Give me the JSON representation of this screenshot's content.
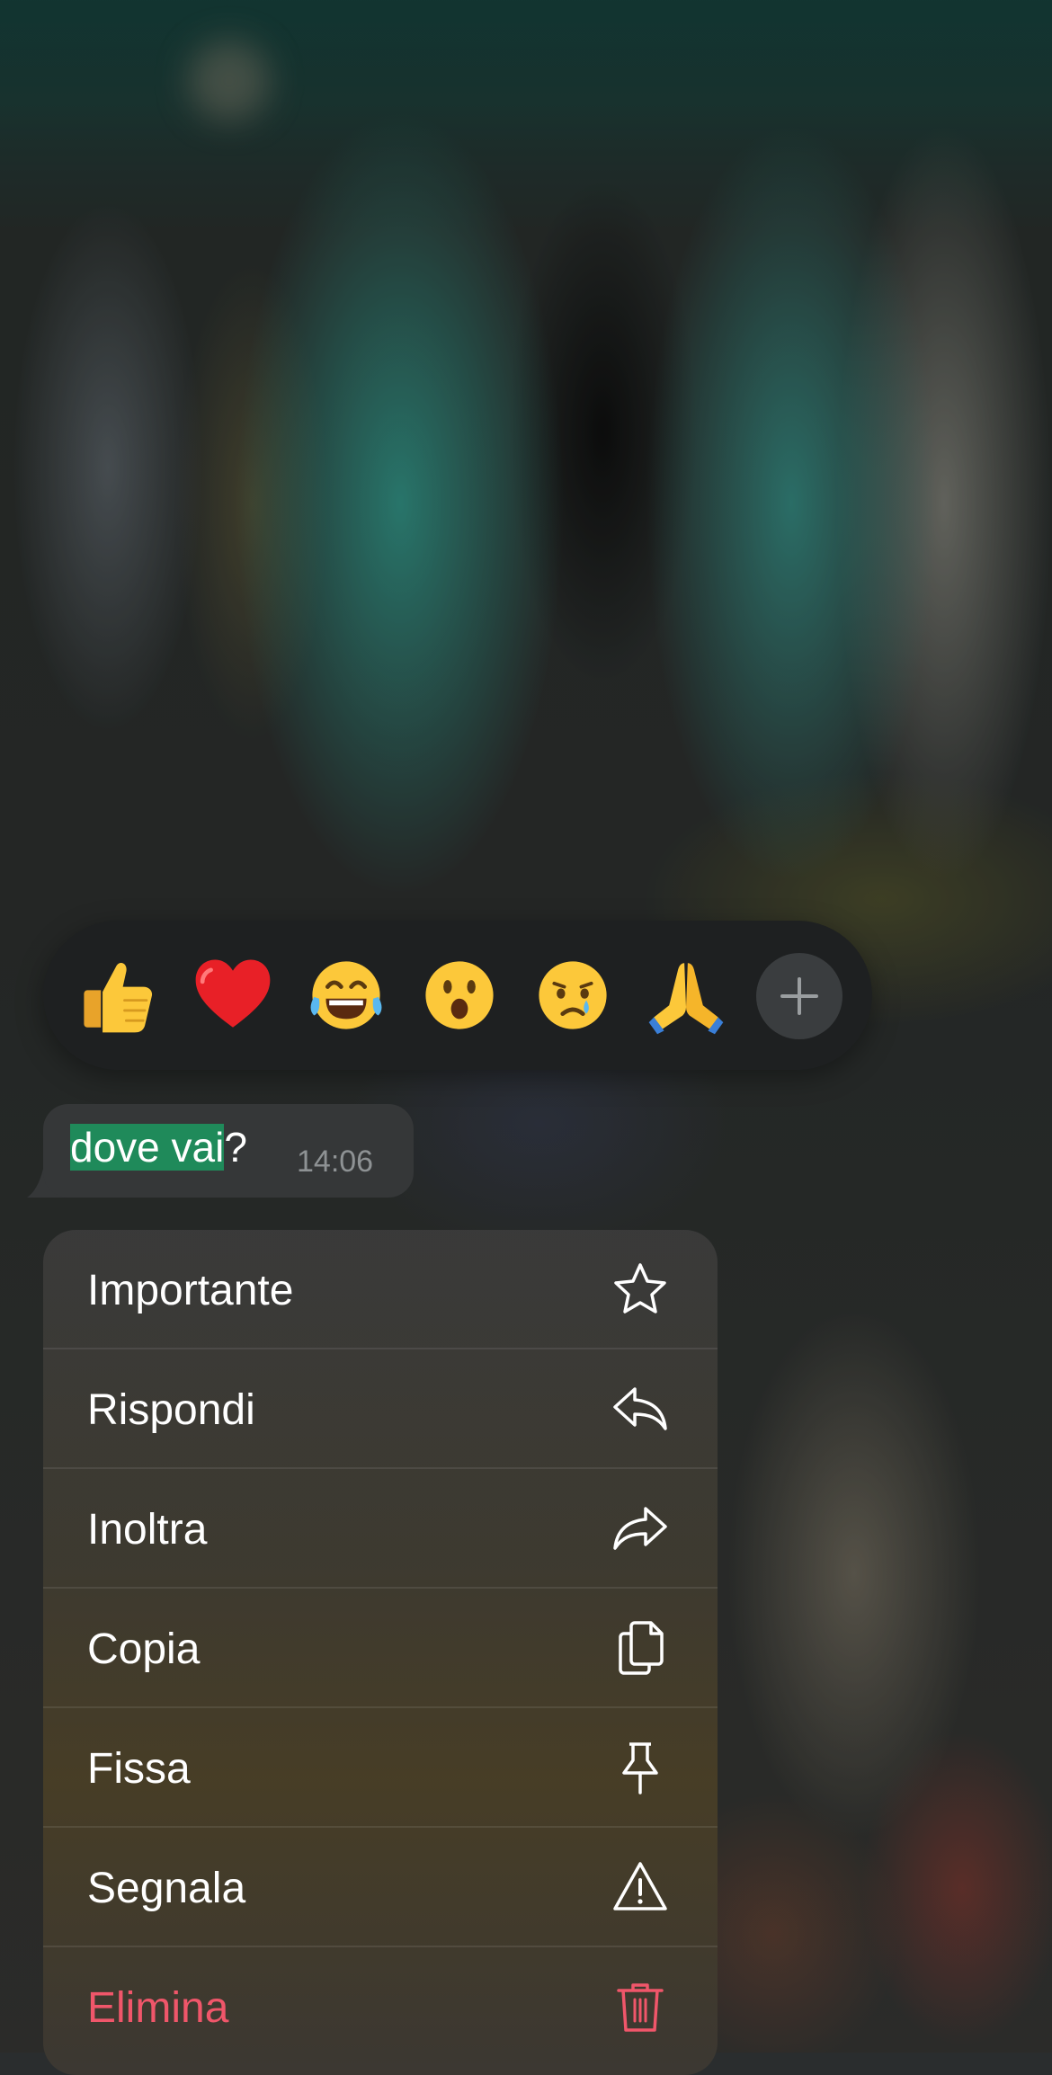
{
  "reactions": {
    "items": [
      {
        "emoji": "👍",
        "icon": "thumbs-up-icon"
      },
      {
        "emoji": "❤️",
        "icon": "red-heart-icon"
      },
      {
        "emoji": "😂",
        "icon": "tears-of-joy-icon"
      },
      {
        "emoji": "😮",
        "icon": "open-mouth-icon"
      },
      {
        "emoji": "😢",
        "icon": "crying-face-icon"
      },
      {
        "emoji": "🙏",
        "icon": "folded-hands-icon"
      }
    ],
    "more_icon": "plus-icon"
  },
  "message": {
    "selected_text": "dove vai",
    "rest_text": "?",
    "time": "14:06"
  },
  "menu": {
    "items": [
      {
        "label": "Importante",
        "icon": "star-icon"
      },
      {
        "label": "Rispondi",
        "icon": "reply-icon"
      },
      {
        "label": "Inoltra",
        "icon": "forward-icon"
      },
      {
        "label": "Copia",
        "icon": "copy-icon"
      },
      {
        "label": "Fissa",
        "icon": "pin-icon"
      },
      {
        "label": "Segnala",
        "icon": "warning-icon"
      },
      {
        "label": "Elimina",
        "icon": "trash-icon"
      }
    ]
  },
  "colors": {
    "selection": "#1f8a5a",
    "danger": "#f0566a",
    "menu_text": "#ffffff"
  }
}
